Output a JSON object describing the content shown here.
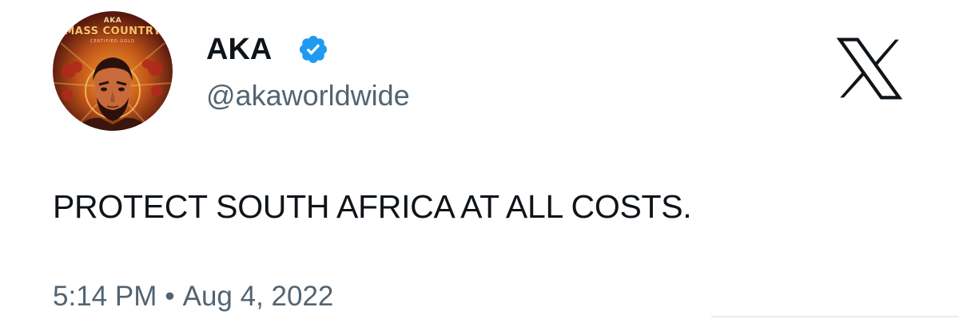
{
  "author": {
    "display_name": "AKA",
    "handle": "@akaworldwide",
    "verified": true,
    "avatar_top_text": "AKA",
    "avatar_title": "MASS COUNTRY",
    "avatar_subtitle": "CERTIFIED GOLD"
  },
  "tweet": {
    "text": "PROTECT SOUTH AFRICA AT ALL COSTS.",
    "time": "5:14 PM",
    "separator": "•",
    "date": "Aug 4, 2022"
  },
  "icons": {
    "verified": "verified-badge-icon",
    "platform": "x-logo-icon"
  },
  "colors": {
    "text_primary": "#0f1419",
    "text_secondary": "#536471",
    "verified_blue": "#1d9bf0",
    "background": "#ffffff"
  }
}
